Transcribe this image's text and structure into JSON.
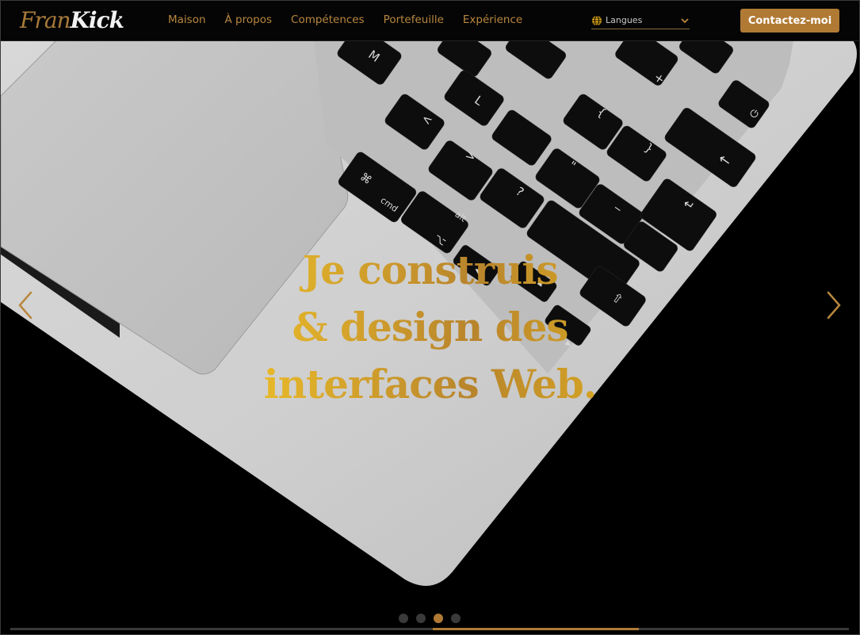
{
  "brand": {
    "logo_part1": "Fran",
    "logo_part2": "Kick"
  },
  "nav": {
    "links": [
      "Maison",
      "À propos",
      "Compétences",
      "Portefeuille",
      "Expérience"
    ]
  },
  "language": {
    "label": "Langues",
    "icon": "globe-icon"
  },
  "contact_button": "Contactez-moi",
  "hero": {
    "headline_lines": [
      "Je construis",
      "& design des",
      "interfaces Web."
    ],
    "carousel": {
      "slides": 4,
      "active_slide": 3,
      "progress": 0.5
    },
    "prev_icon": "chevron-left-icon",
    "next_icon": "chevron-right-icon"
  },
  "keyboard_keys": {
    "row1": [
      "M",
      "<",
      ">",
      "?"
    ],
    "labels": [
      "cmd",
      "alt"
    ],
    "glyphs": [
      "L",
      ":",
      "\"",
      "{",
      "}",
      "+",
      "=",
      "_",
      "-",
      "~"
    ]
  },
  "colors": {
    "accent": "#b07a35",
    "gold": "#e8b820",
    "nav_bg": "#050505"
  }
}
